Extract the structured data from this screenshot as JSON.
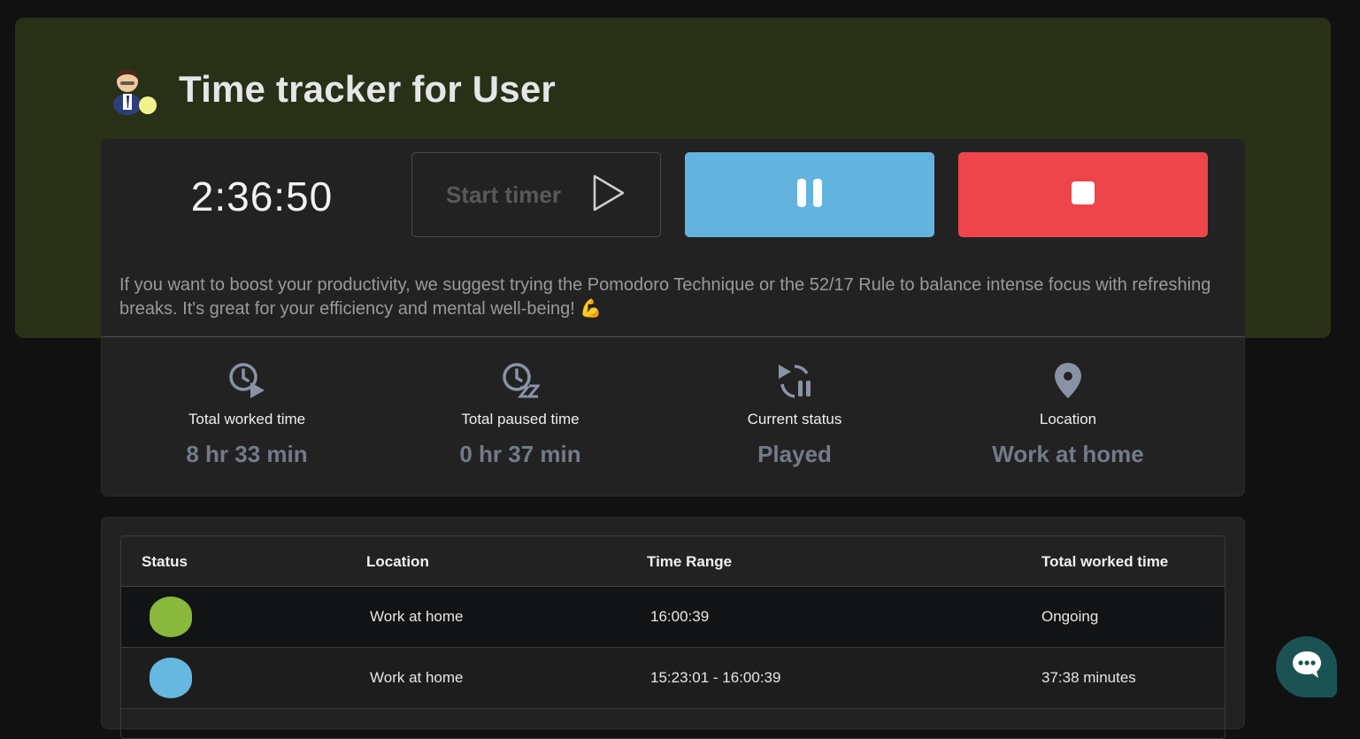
{
  "header": {
    "title": "Time tracker for User"
  },
  "timer": {
    "elapsed": "2:36:50",
    "start_label": "Start timer",
    "tip": "If you want to boost your productivity, we suggest trying the Pomodoro Technique or the 52/17 Rule to balance intense focus with refreshing breaks. It's great for your efficiency and mental well-being! 💪"
  },
  "stats": [
    {
      "label": "Total worked time",
      "value": "8 hr 33 min",
      "icon": "clock-play-icon"
    },
    {
      "label": "Total paused time",
      "value": "0 hr 37 min",
      "icon": "clock-snooze-icon"
    },
    {
      "label": "Current status",
      "value": "Played",
      "icon": "play-pause-cycle-icon"
    },
    {
      "label": "Location",
      "value": "Work at home",
      "icon": "map-pin-icon"
    }
  ],
  "table": {
    "columns": [
      "Status",
      "Location",
      "Time Range",
      "Total worked time"
    ],
    "rows": [
      {
        "status_color": "#8ab83c",
        "location": "Work at home",
        "range": "16:00:39",
        "total": "Ongoing"
      },
      {
        "status_color": "#66b8e0",
        "location": "Work at home",
        "range": "15:23:01 - 16:00:39",
        "total": "37:38 minutes"
      }
    ]
  },
  "colors": {
    "pause": "#62b3de",
    "stop": "#ee454b",
    "hero_bg": "#283118",
    "chat": "#1b5355"
  }
}
